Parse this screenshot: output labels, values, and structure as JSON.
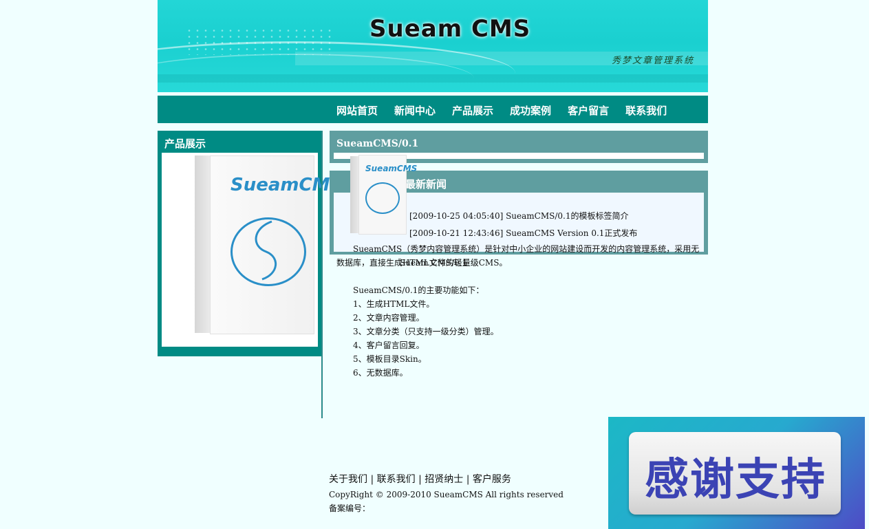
{
  "header": {
    "site_title": "Sueam CMS",
    "subtitle": "秀梦文章管理系统"
  },
  "nav": {
    "items": [
      "网站首页",
      "新闻中心",
      "产品展示",
      "成功案例",
      "客户留言",
      "联系我们"
    ]
  },
  "sidebar": {
    "title": "产品展示",
    "product_brand": "SueamCMS"
  },
  "product_section": {
    "title": "SueamCMS/0.1"
  },
  "news_section": {
    "title": "最新新闻",
    "items": [
      "[2009-10-25 04:05:40] SueamCMS/0.1的模板标签简介",
      "[2009-10-21 12:43:46] SueamCMS Version 0.1正式发布"
    ]
  },
  "content": {
    "intro": "SueamCMS（秀梦内容管理系统）是针对中小企业的网站建设而开发的内容管理系统，采用无数据库，直接生成HTML文件的轻量级CMS。",
    "overlap_text": "Sueam CMS/0.1",
    "features_title": "SueamCMS/0.1的主要功能如下：",
    "features": [
      "1、生成HTML文件。",
      "2、文章内容管理。",
      "3、文章分类（只支持一级分类）管理。",
      "4、客户留言回复。",
      "5、模板目录Skin。",
      "6、无数据库。"
    ]
  },
  "footer": {
    "links": [
      "关于我们",
      "联系我们",
      "招贤纳士",
      "客户服务"
    ],
    "separator": "|",
    "copyright": "CopyRight © 2009-2010 SueamCMS All rights reserved",
    "beian_label": "备案编号："
  },
  "thanks_badge": {
    "label": "感谢支持"
  },
  "colors": {
    "nav_bg": "#008b84",
    "section_bg": "#5f9ea0",
    "page_bg": "#f0ffff",
    "brand_blue": "#2a8fc8"
  }
}
